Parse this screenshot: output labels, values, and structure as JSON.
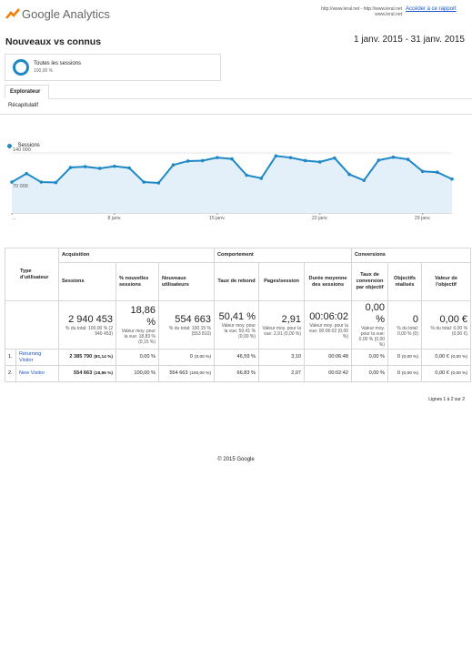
{
  "header": {
    "brand": "Google Analytics",
    "url_line1": "http://www.leral.net - http://www.leral.net",
    "url_line2": "www.leral.net",
    "report_link": "Accéder à ce rapport"
  },
  "title": "Nouveaux vs connus",
  "date_range": "1 janv. 2015 - 31 janv. 2015",
  "segment": {
    "label": "Toutes les sessions",
    "pct": "100,00 %"
  },
  "tab": "Explorateur",
  "subtab": "Récapitulatif",
  "chart_data": {
    "type": "area",
    "legend": "Sessions",
    "color": "#1e88c7",
    "fill": "#e3f0f9",
    "y_ticks": [
      "140 000",
      "70 000"
    ],
    "ylim": [
      0,
      140000
    ],
    "x_tick_labels": [
      "...",
      "8 janv.",
      "15 janv.",
      "22 janv.",
      "29 janv."
    ],
    "x": [
      "1 janv.",
      "2 janv.",
      "3 janv.",
      "4 janv.",
      "5 janv.",
      "6 janv.",
      "7 janv.",
      "8 janv.",
      "9 janv.",
      "10 janv.",
      "11 janv.",
      "12 janv.",
      "13 janv.",
      "14 janv.",
      "15 janv.",
      "16 janv.",
      "17 janv.",
      "18 janv.",
      "19 janv.",
      "20 janv.",
      "21 janv.",
      "22 janv.",
      "23 janv.",
      "24 janv.",
      "25 janv.",
      "26 janv.",
      "27 janv.",
      "28 janv.",
      "29 janv.",
      "30 janv.",
      "31 janv."
    ],
    "values": [
      72000,
      92000,
      72000,
      71000,
      106000,
      108000,
      104000,
      109000,
      105000,
      72000,
      70000,
      112000,
      121000,
      122000,
      129000,
      126000,
      88000,
      81000,
      133000,
      129000,
      122000,
      119000,
      128000,
      90000,
      76000,
      123000,
      130000,
      125000,
      97000,
      95000,
      79000
    ]
  },
  "table": {
    "dim_header": "Type d'utilisateur",
    "groups": [
      "Acquisition",
      "Comportement",
      "Conversions"
    ],
    "columns": [
      "Sessions",
      "% nouvelles sessions",
      "Nouveaux utilisateurs",
      "Taux de rebond",
      "Pages/session",
      "Durée moyenne des sessions",
      "Taux de conversion par objectif",
      "Objectifs réalisés",
      "Valeur de l'objectif"
    ],
    "totals": [
      {
        "value": "2 940 453",
        "sub": "% du total: 100,00 % (2 940 453)"
      },
      {
        "value": "18,86 %",
        "sub": "Valeur moy. pour la vue: 18,83 % (0,15 %)"
      },
      {
        "value": "554 663",
        "sub": "% du total: 100,15 % (553 810)"
      },
      {
        "value": "50,41 %",
        "sub": "Valeur moy. pour la vue: 50,41 % (0,00 %)"
      },
      {
        "value": "2,91",
        "sub": "Valeur moy. pour la vue: 2,91 (0,00 %)"
      },
      {
        "value": "00:06:02",
        "sub": "Valeur moy. pour la vue: 00:06:02 (0,00 %)"
      },
      {
        "value": "0,00 %",
        "sub": "Valeur moy. pour la vue: 0,00 % (0,00 %)"
      },
      {
        "value": "0",
        "sub": "% du total: 0,00 % (0)"
      },
      {
        "value": "0,00 €",
        "sub": "% du total: 0,00 % (0,00 €)"
      }
    ],
    "rows": [
      {
        "n": "1.",
        "name": "Returning Visitor",
        "cells": [
          "2 385 790",
          "(81,14 %)",
          "0,00 %",
          "0",
          "(0,00 %)",
          "46,59 %",
          "3,10",
          "00:06:48",
          "0,00 %",
          "0",
          "(0,00 %)",
          "0,00 €",
          "(0,00 %)"
        ]
      },
      {
        "n": "2.",
        "name": "New Visitor",
        "cells": [
          "554 663",
          "(18,86 %)",
          "100,00 %",
          "554 663",
          "(100,00 %)",
          "66,83 %",
          "2,07",
          "00:02:42",
          "0,00 %",
          "0",
          "(0,00 %)",
          "0,00 €",
          "(0,00 %)"
        ]
      }
    ],
    "pagination": "Lignes 1 à 2 sur 2"
  },
  "footer": "© 2015 Google"
}
